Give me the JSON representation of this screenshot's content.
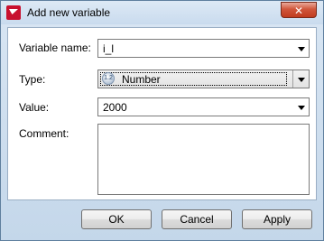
{
  "window": {
    "title": "Add new variable",
    "close_glyph": "✕"
  },
  "form": {
    "name_label": "Variable name:",
    "name_value": "i_l",
    "type_label": "Type:",
    "type_value": "Number",
    "type_icon": "number-type-icon",
    "value_label": "Value:",
    "value_value": "2000",
    "comment_label": "Comment:",
    "comment_value": ""
  },
  "buttons": {
    "ok": "OK",
    "cancel": "Cancel",
    "apply": "Apply"
  }
}
